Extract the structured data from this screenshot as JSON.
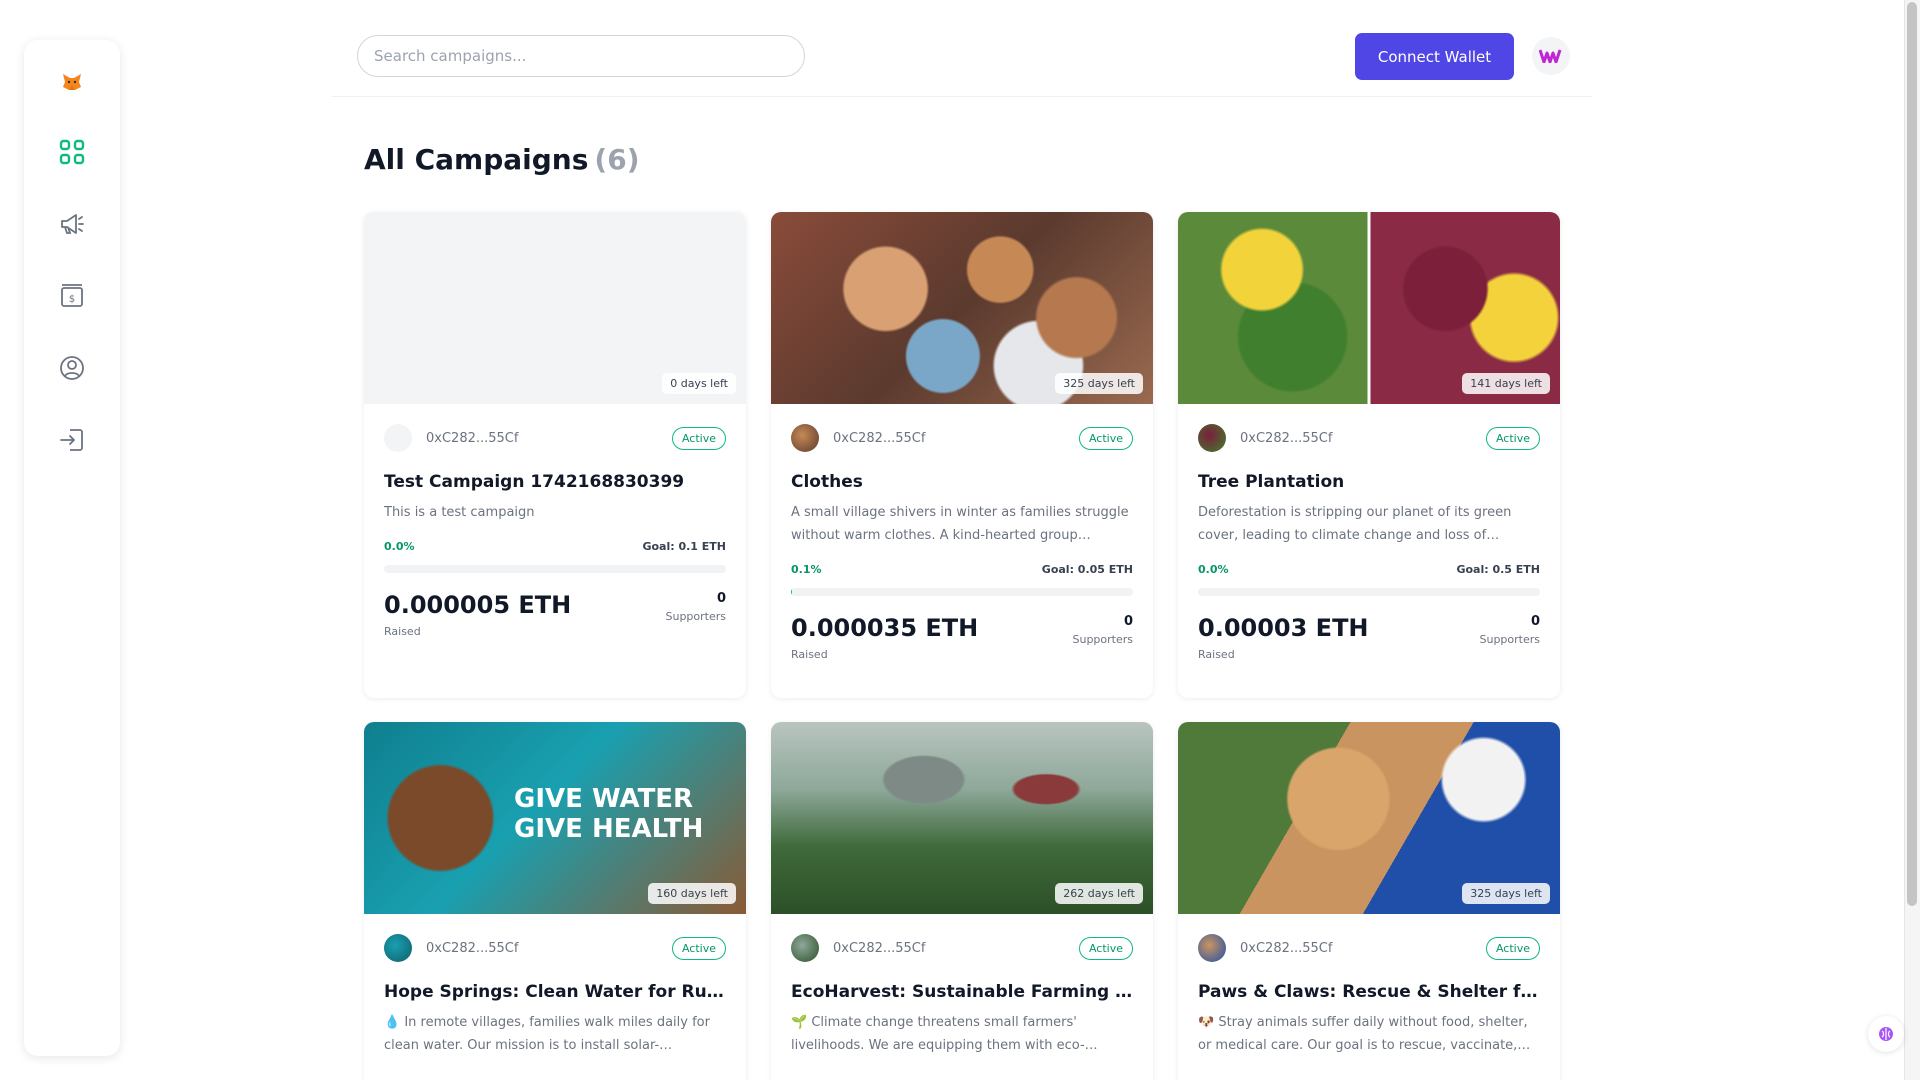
{
  "header": {
    "search_placeholder": "Search campaigns...",
    "connect_label": "Connect Wallet"
  },
  "page": {
    "title": "All Campaigns",
    "count": "(6)"
  },
  "sidebar": {
    "items": [
      "dashboard-icon",
      "megaphone-icon",
      "payment-icon",
      "profile-icon",
      "logout-icon"
    ],
    "accent": "#10b981"
  },
  "campaigns": [
    {
      "days_left": "0 days left",
      "owner": "0xC282...55Cf",
      "status": "Active",
      "title": "Test Campaign 1742168830399",
      "description": "This is a test campaign",
      "percent": "0.0%",
      "goal": "Goal: 0.1 ETH",
      "progress": 0.0,
      "raised": "0.000005 ETH",
      "raised_label": "Raised",
      "supporters": "0",
      "supporters_label": "Supporters"
    },
    {
      "days_left": "325 days left",
      "owner": "0xC282...55Cf",
      "status": "Active",
      "title": "Clothes",
      "description": "A small village shivers in winter as families struggle without warm clothes. A kind-hearted group launche...",
      "percent": "0.1%",
      "goal": "Goal: 0.05 ETH",
      "progress": 0.001,
      "raised": "0.000035 ETH",
      "raised_label": "Raised",
      "supporters": "0",
      "supporters_label": "Supporters"
    },
    {
      "days_left": "141 days left",
      "owner": "0xC282...55Cf",
      "status": "Active",
      "title": "Tree Plantation",
      "description": "Deforestation is stripping our planet of its green cover, leading to climate change and loss of wildlife. Our...",
      "percent": "0.0%",
      "goal": "Goal: 0.5 ETH",
      "progress": 0.0,
      "raised": "0.00003 ETH",
      "raised_label": "Raised",
      "supporters": "0",
      "supporters_label": "Supporters"
    },
    {
      "days_left": "160 days left",
      "owner": "0xC282...55Cf",
      "status": "Active",
      "title": "Hope Springs: Clean Water for Rural...",
      "description": "💧 In remote villages, families walk miles daily for clean water. Our mission is to install solar-powered...",
      "image_text": "GIVE WATER GIVE HEALTH"
    },
    {
      "days_left": "262 days left",
      "owner": "0xC282...55Cf",
      "status": "Active",
      "title": "EcoHarvest: Sustainable Farming for...",
      "description": "🌱 Climate change threatens small farmers' livelihoods. We are equipping them with eco-friendly..."
    },
    {
      "days_left": "325 days left",
      "owner": "0xC282...55Cf",
      "status": "Active",
      "title": "Paws & Claws: Rescue & Shelter for Str...",
      "description": "🐶 Stray animals suffer daily without food, shelter, or medical care. Our goal is to rescue, vaccinate, and fin..."
    }
  ]
}
